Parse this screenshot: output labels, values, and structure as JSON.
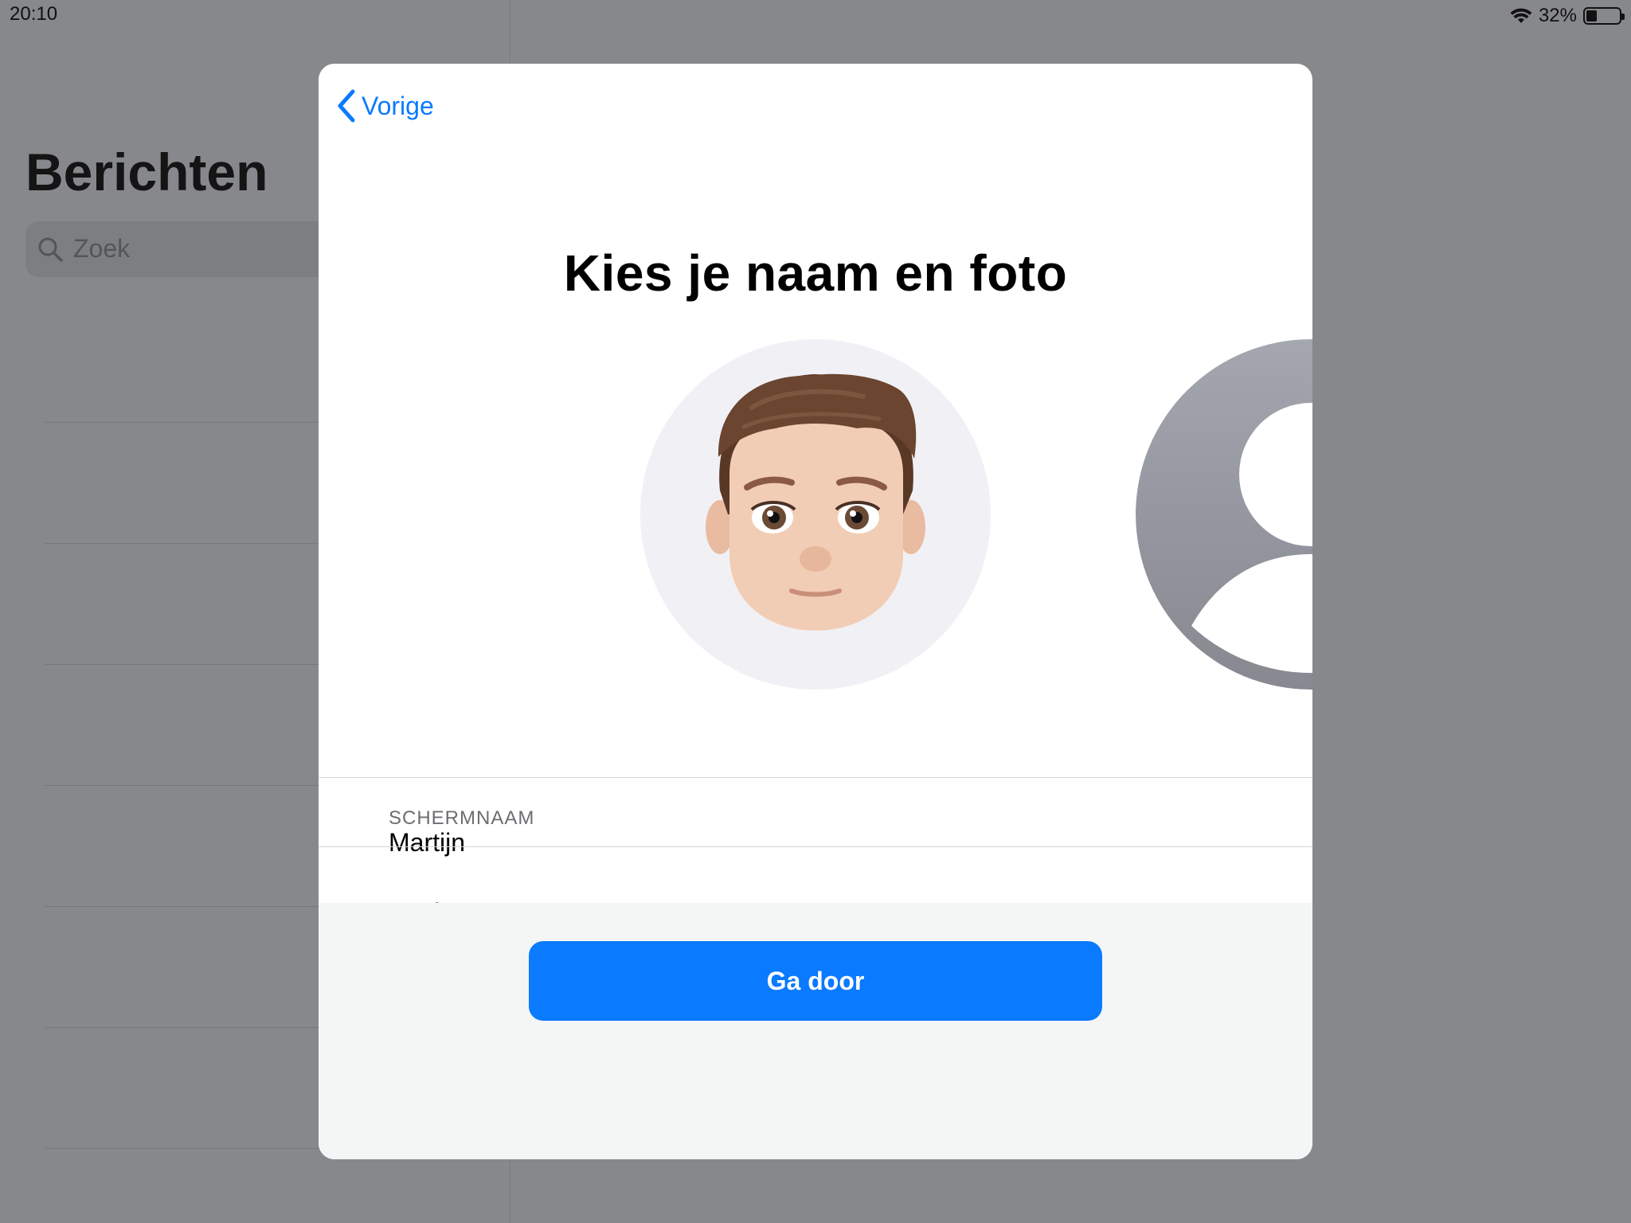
{
  "status_bar": {
    "time": "20:10",
    "battery_percent": "32%",
    "battery_level": 0.32,
    "wifi_icon": "wifi-icon"
  },
  "background": {
    "title": "Berichten",
    "search_placeholder": "Zoek"
  },
  "sheet": {
    "back_label": "Vorige",
    "heading": "Kies je naam en foto",
    "section_label": "SCHERMNAAM",
    "first_name": "Martijn",
    "last_name": "Engler",
    "continue_label": "Ga door"
  },
  "colors": {
    "accent": "#0a7aff",
    "dimmed_background": "#87888c",
    "avatar_bg": "#f1f1f5"
  }
}
